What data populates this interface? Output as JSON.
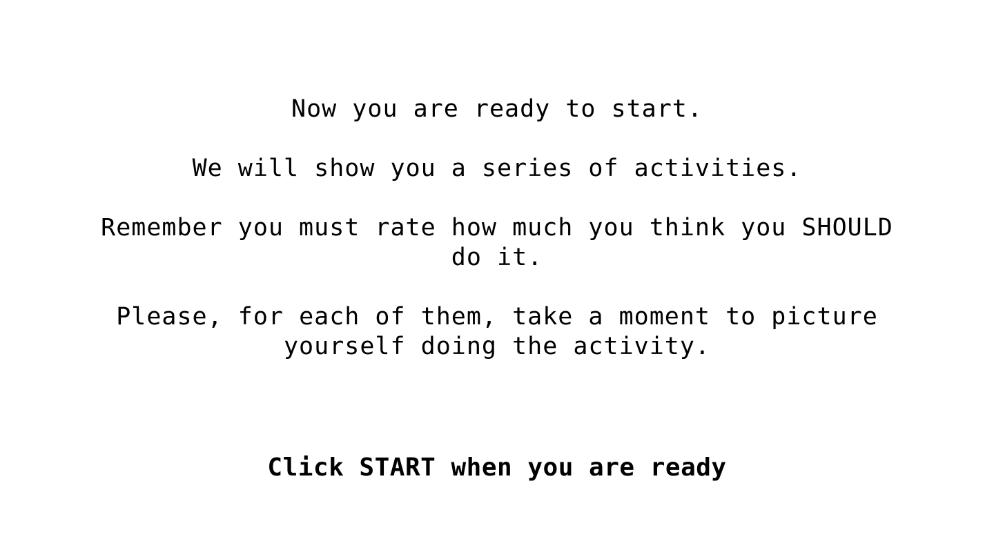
{
  "instructions": {
    "line1": "Now you are ready to start.",
    "line2": "We will show you a series of activities.",
    "line3": "Remember you must rate how much you think you SHOULD do it.",
    "line4": "Please, for each of them, take a moment to picture yourself doing the activity."
  },
  "prompt": {
    "text": "Click START when you are ready"
  }
}
